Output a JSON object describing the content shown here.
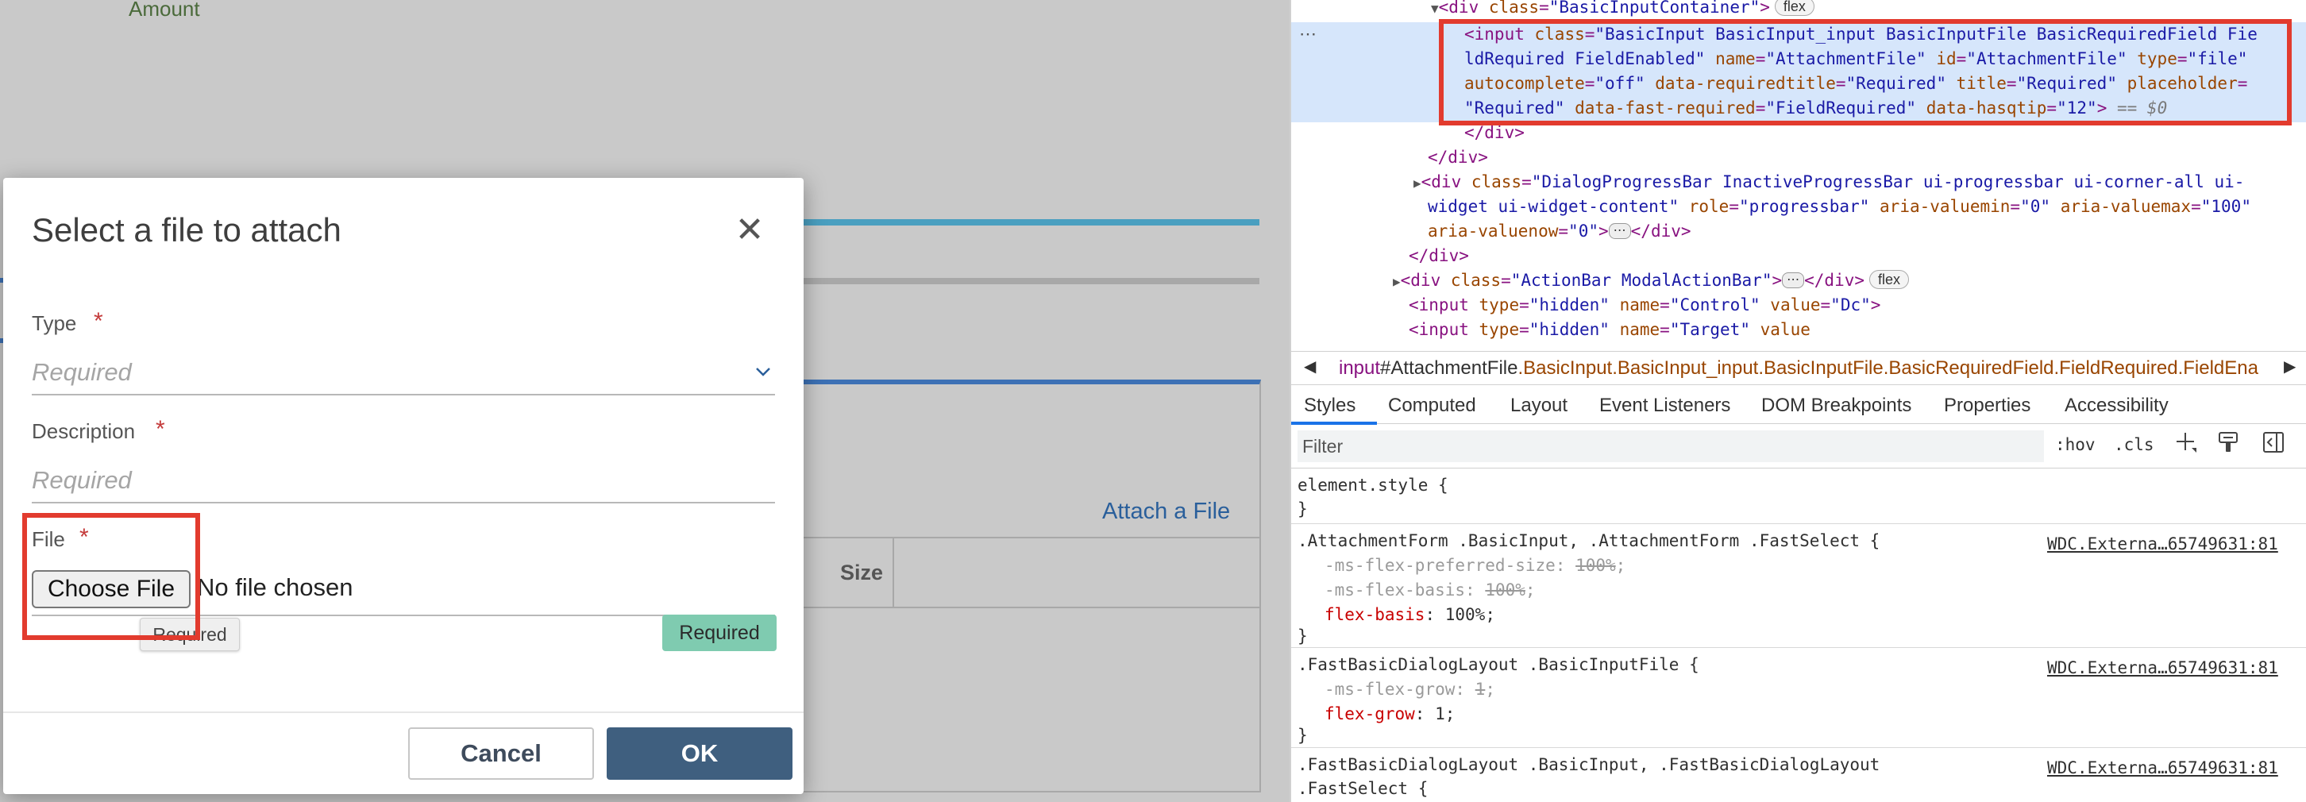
{
  "background_page": {
    "amount_label": "Amount",
    "attach_link": "Attach a File",
    "size_header": "Size"
  },
  "modal": {
    "title": "Select a file to attach",
    "close_glyph": "✕",
    "type_label": "Type",
    "type_placeholder": "Required",
    "description_label": "Description",
    "description_placeholder": "Required",
    "file_label": "File",
    "choose_file_button": "Choose File",
    "no_file_text": "No file chosen",
    "tooltip_text": "Required",
    "required_badge": "Required",
    "required_star": "*",
    "cancel_button": "Cancel",
    "ok_button": "OK"
  },
  "devtools": {
    "gutter_dots": "⋯",
    "dom": {
      "container_class": "BasicInputContainer",
      "flex_badge": "flex",
      "input_class_line1": "BasicInput BasicInput_input BasicInputFile BasicRequiredField Fie",
      "input_class_line2": "ldRequired FieldEnabled",
      "input_name": "AttachmentFile",
      "input_id": "AttachmentFile",
      "input_type": "file",
      "autocomplete": "off",
      "data_requiredtitle": "Required",
      "title": "Required",
      "placeholder_line1": "",
      "placeholder_line2": "Required",
      "data_fast_required": "FieldRequired",
      "data_hasqtip": "12",
      "selected_marker": "== $0",
      "close_div_1": "</div>",
      "close_div_2": "</div>",
      "progress_class_line1": "DialogProgressBar InactiveProgressBar ui-progressbar ui-corner-all ui-",
      "progress_class_line2": "widget ui-widget-content",
      "progress_role": "progressbar",
      "progress_min": "0",
      "progress_max": "100",
      "progress_now": "0",
      "ellipsis": "⋯",
      "close_div_3": "</div>",
      "actionbar_class": "ActionBar ModalActionBar",
      "hidden1_name": "Control",
      "hidden1_value": "Dc",
      "hidden2_name": "Target",
      "hidden_type": "hidden"
    },
    "breadcrumb": {
      "tag": "input",
      "id": "#AttachmentFile",
      "classes": ".BasicInput.BasicInput_input.BasicInputFile.BasicRequiredField.FieldRequired.FieldEna"
    },
    "tabs": [
      "Styles",
      "Computed",
      "Layout",
      "Event Listeners",
      "DOM Breakpoints",
      "Properties",
      "Accessibility"
    ],
    "filter_placeholder": "Filter",
    "filter_buttons": [
      ":hov",
      ".cls"
    ],
    "rules": {
      "element_style": {
        "selector": "element.style {",
        "close": "}"
      },
      "rule1": {
        "selector": ".AttachmentForm .BasicInput, .AttachmentForm .FastSelect {",
        "source": "WDC.Externa…65749631:81",
        "p1_name": "-ms-flex-preferred-size",
        "p1_value": "100%",
        "p2_name": "-ms-flex-basis",
        "p2_value": "100%",
        "p3_name": "flex-basis",
        "p3_value": "100%",
        "close": "}"
      },
      "rule2": {
        "selector": ".FastBasicDialogLayout .BasicInputFile {",
        "source": "WDC.Externa…65749631:81",
        "p1_name": "-ms-flex-grow",
        "p1_value": "1",
        "p2_name": "flex-grow",
        "p2_value": "1",
        "close": "}"
      },
      "rule3": {
        "selector_line1": ".FastBasicDialogLayout .BasicInput, .FastBasicDialogLayout",
        "selector_line2": ".FastSelect {",
        "source": "WDC.Externa…65749631:81"
      }
    }
  },
  "colors": {
    "highlight": "#e23b2e",
    "ok_button": "#3f5f7f",
    "required_badge": "#7fcbb0",
    "selected_row": "#d6e6fb",
    "tab_active": "#1a73e8"
  }
}
